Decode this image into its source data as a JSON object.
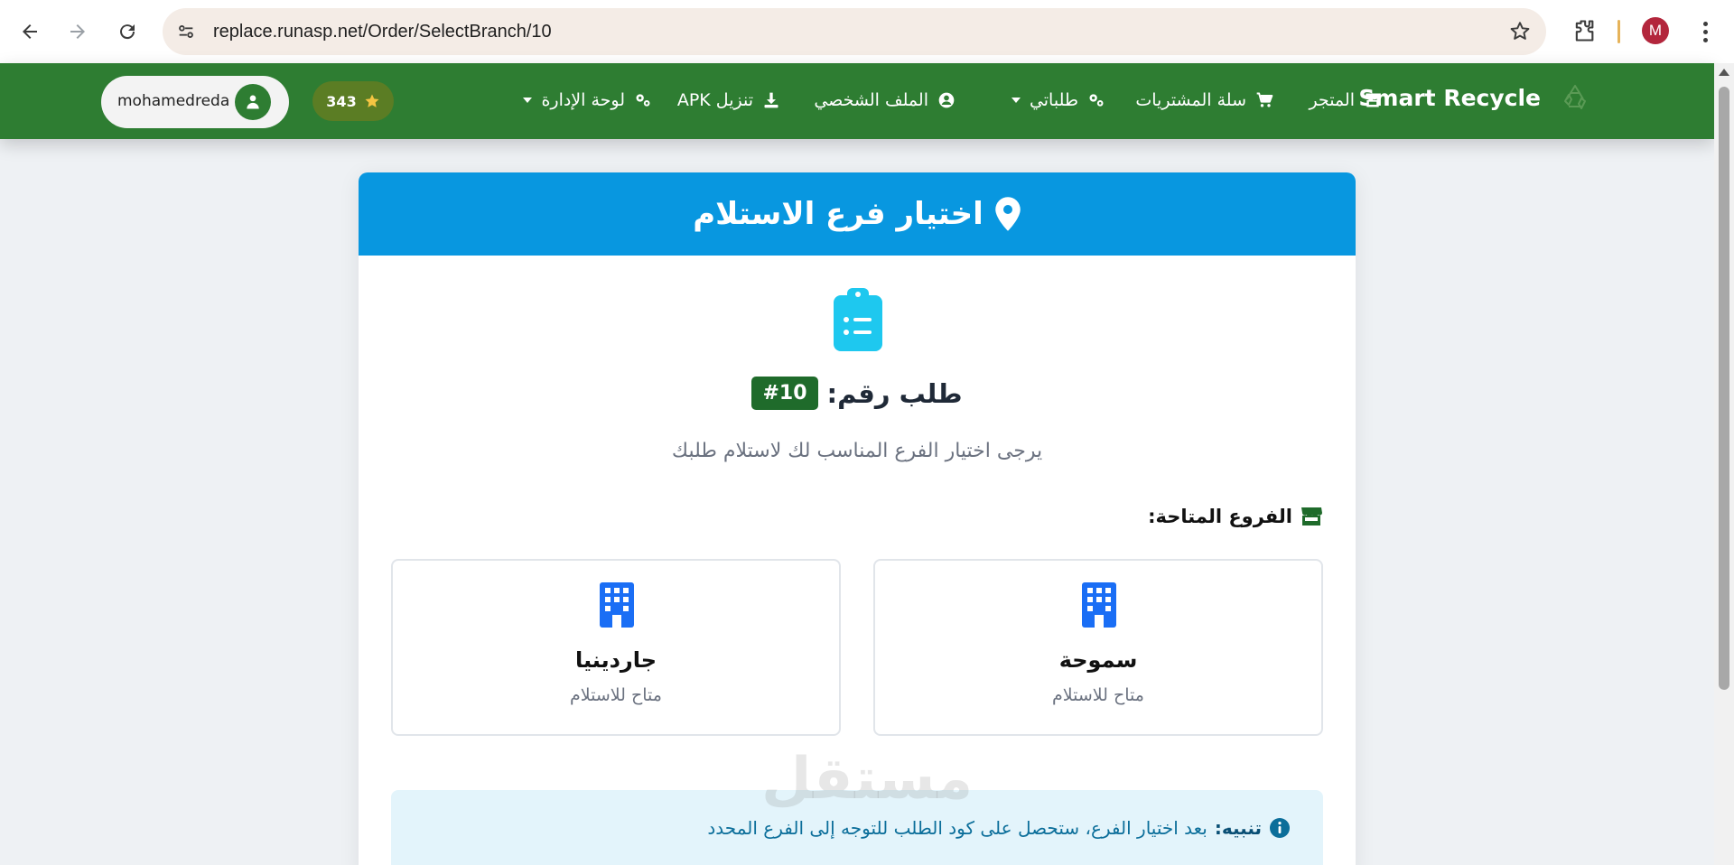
{
  "browser": {
    "url": "replace.runasp.net/Order/SelectBranch/10",
    "profile_initial": "M",
    "back_icon": "arrow-left-icon",
    "forward_icon": "arrow-right-icon",
    "reload_icon": "reload-icon",
    "bookmark_icon": "star-outline-icon",
    "extensions_icon": "puzzle-icon"
  },
  "navbar": {
    "brand": "Smart Recycle",
    "items": [
      {
        "label": "المتجر",
        "icon": "store-icon"
      },
      {
        "label": "سلة المشتريات",
        "icon": "cart-icon"
      },
      {
        "label": "طلباتي",
        "icon": "gears-icon",
        "dropdown": true
      },
      {
        "label": "الملف الشخصي",
        "icon": "user-circle-icon"
      },
      {
        "label": "تنزيل APK",
        "icon": "download-icon"
      },
      {
        "label": "لوحة الإدارة",
        "icon": "gears-icon",
        "dropdown": true
      }
    ],
    "points": "343",
    "username": "mohamedreda",
    "colors": {
      "bar": "#2e7d32",
      "points_pill": "#5b7d24"
    }
  },
  "page": {
    "header_title": "اختيار فرع الاستلام",
    "order_label": "طلب رقم:",
    "order_number": "#10",
    "subtitle": "يرجى اختيار الفرع المناسب لك لاستلام طلبك",
    "branches_title": "الفروع المتاحة:",
    "branches": [
      {
        "name": "سموحة",
        "status": "متاح للاستلام"
      },
      {
        "name": "جاردينيا",
        "status": "متاح للاستلام"
      }
    ],
    "alert_label": "تنبيه:",
    "alert_text": "بعد اختيار الفرع، ستحصل على كود الطلب للتوجه إلى الفرع المحدد",
    "colors": {
      "header": "#0897e0",
      "badge": "#1f6b2b",
      "building": "#1a6ef5",
      "clipboard": "#1ec8ef"
    }
  },
  "watermark": "مستقل"
}
